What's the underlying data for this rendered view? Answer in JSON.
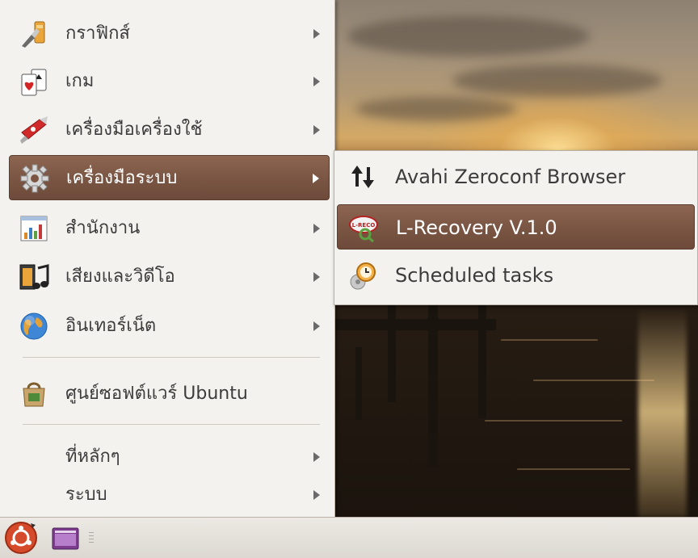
{
  "menu": {
    "items": [
      {
        "label": "กราฟิกส์",
        "icon": "graphics-icon",
        "submenu": true
      },
      {
        "label": "เกม",
        "icon": "games-cards-icon",
        "submenu": true
      },
      {
        "label": "เครื่องมือเครื่องใช้",
        "icon": "accessories-knife-icon",
        "submenu": true
      },
      {
        "label": "เครื่องมือระบบ",
        "icon": "system-gear-icon",
        "submenu": true,
        "active": true
      },
      {
        "label": "สำนักงาน",
        "icon": "office-spreadsheet-icon",
        "submenu": true
      },
      {
        "label": "เสียงและวิดีโอ",
        "icon": "sound-video-icon",
        "submenu": true
      },
      {
        "label": "อินเทอร์เน็ต",
        "icon": "internet-globe-icon",
        "submenu": true
      },
      {
        "label": "ศูนย์ซอฟต์แวร์ Ubuntu",
        "icon": "software-center-icon",
        "submenu": false
      },
      {
        "label": "ที่หลักๆ",
        "icon": "",
        "submenu": true
      },
      {
        "label": "ระบบ",
        "icon": "",
        "submenu": true
      }
    ]
  },
  "submenu": {
    "items": [
      {
        "label": "Avahi Zeroconf Browser",
        "icon": "avahi-arrows-icon"
      },
      {
        "label": "L-Recovery V.1.0",
        "icon": "l-recovery-icon",
        "active": true,
        "icon_text": "L-RECO"
      },
      {
        "label": "Scheduled tasks",
        "icon": "scheduled-tasks-clock-icon"
      }
    ]
  },
  "colors": {
    "highlight": "#7b5644",
    "menu_bg": "#f4f2ee",
    "text": "#3c3c3c"
  }
}
